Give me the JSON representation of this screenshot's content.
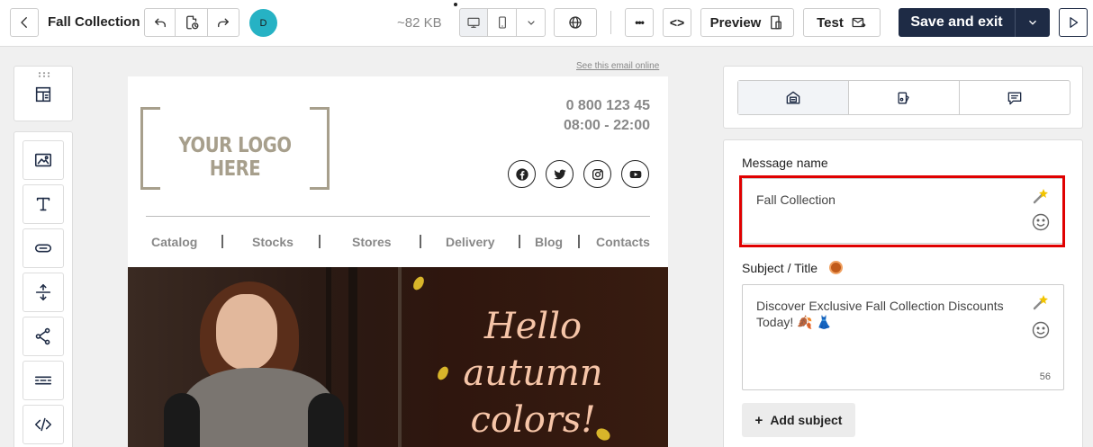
{
  "header": {
    "title": "Fall Collection",
    "avatar_initial": "D",
    "size": "~82 KB",
    "preview_label": "Preview",
    "test_label": "Test",
    "save_label": "Save and exit",
    "more_label": "•••",
    "code_label": "<>"
  },
  "email": {
    "see_online": "See this email online",
    "logo_text": "YOUR LOGO HERE",
    "phone": "0 800 123 45",
    "hours": "08:00 - 22:00",
    "nav": [
      "Catalog",
      "Stocks",
      "Stores",
      "Delivery",
      "Blog",
      "Contacts"
    ],
    "hero_line1": "Hello",
    "hero_line2": "autumn",
    "hero_line3": "colors!"
  },
  "panel": {
    "message_name_label": "Message name",
    "message_name_value": "Fall Collection",
    "subject_label": "Subject / Title",
    "subject_value": "Discover Exclusive Fall Collection Discounts Today! 🍂 👗",
    "subject_count": "56",
    "add_subject_label": "Add subject"
  },
  "colors": {
    "primary": "#1e2b45",
    "avatar": "#26b2c4",
    "highlight": "#e00000"
  }
}
